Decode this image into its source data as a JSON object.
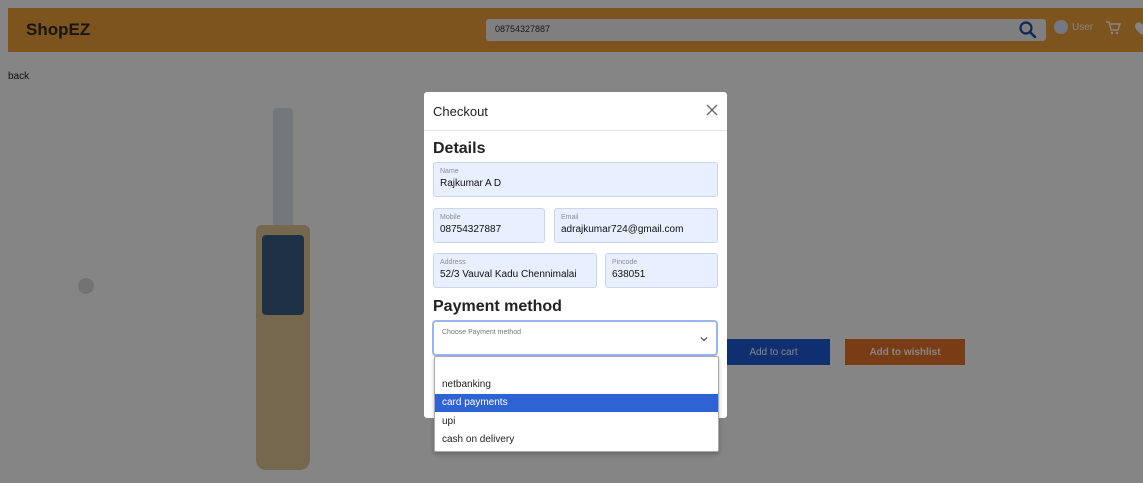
{
  "header": {
    "brand": "ShopEZ",
    "search_value": "08754327887",
    "user_label": "User"
  },
  "page": {
    "back_label": "back",
    "add_to_cart_label": "Add to cart",
    "add_to_wishlist_label": "Add to wishlist"
  },
  "modal": {
    "title": "Checkout",
    "details_heading": "Details",
    "fields": {
      "name": {
        "label": "Name",
        "value": "Rajkumar A D"
      },
      "mobile": {
        "label": "Mobile",
        "value": "08754327887"
      },
      "email": {
        "label": "Email",
        "value": "adrajkumar724@gmail.com"
      },
      "address": {
        "label": "Address",
        "value": "52/3 Vauval Kadu Chennimalai"
      },
      "pincode": {
        "label": "Pincode",
        "value": "638051"
      }
    },
    "payment_heading": "Payment method",
    "payment_placeholder": "Choose Payment method",
    "payment_options": [
      "netbanking",
      "card payments",
      "upi",
      "cash on delivery"
    ],
    "highlighted_option": "card payments"
  },
  "colors": {
    "navbar": "#f0a23b",
    "primary_button": "#1d5bd6",
    "wishlist_button": "#e8742a",
    "field_bg": "#e8efff",
    "option_highlight": "#2f63d4"
  },
  "icons": {
    "search": "search-icon",
    "user": "user-icon",
    "cart": "cart-icon",
    "wishlist": "heart-icon",
    "close": "close-icon",
    "dropdown": "chevron-down-icon"
  }
}
